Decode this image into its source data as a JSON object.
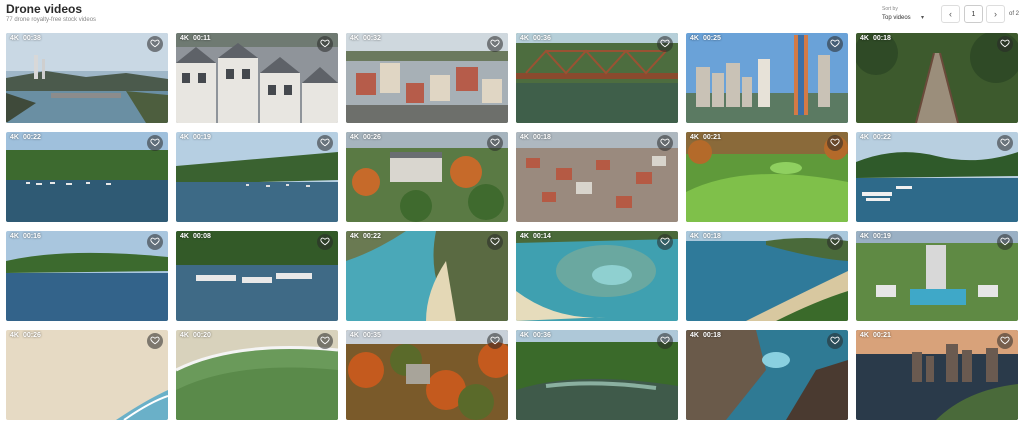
{
  "header": {
    "title": "Drone videos",
    "subtitle": "77 drone royalty-free stock videos"
  },
  "sort": {
    "label": "Sort by",
    "value": "Top videos"
  },
  "pagination": {
    "current_page": "1",
    "of_label": "of 2"
  },
  "colors": {
    "badge_text": "#ffffff",
    "fav_bg": "#3a3a3a"
  },
  "videos": [
    {
      "quality": "4K",
      "duration": "00:38",
      "scene": "river-dam-power-plant"
    },
    {
      "quality": "4K",
      "duration": "00:11",
      "scene": "townhouse-rooftops"
    },
    {
      "quality": "4K",
      "duration": "00:32",
      "scene": "small-city-downtown"
    },
    {
      "quality": "4K",
      "duration": "00:36",
      "scene": "rusty-truss-bridge"
    },
    {
      "quality": "4K",
      "duration": "00:25",
      "scene": "city-skyscrapers"
    },
    {
      "quality": "4K",
      "duration": "00:18",
      "scene": "forest-footbridge"
    },
    {
      "quality": "4K",
      "duration": "00:22",
      "scene": "lake-marina"
    },
    {
      "quality": "4K",
      "duration": "00:19",
      "scene": "lake-docks"
    },
    {
      "quality": "4K",
      "duration": "00:26",
      "scene": "campus-autumn"
    },
    {
      "quality": "4K",
      "duration": "00:18",
      "scene": "town-aerial"
    },
    {
      "quality": "4K",
      "duration": "00:21",
      "scene": "golf-course"
    },
    {
      "quality": "4K",
      "duration": "00:22",
      "scene": "lake-boats"
    },
    {
      "quality": "4K",
      "duration": "00:16",
      "scene": "wide-lake"
    },
    {
      "quality": "4K",
      "duration": "00:08",
      "scene": "marina-boats"
    },
    {
      "quality": "4K",
      "duration": "00:22",
      "scene": "tropical-bay"
    },
    {
      "quality": "4K",
      "duration": "00:14",
      "scene": "reef-bay"
    },
    {
      "quality": "4K",
      "duration": "00:18",
      "scene": "coast-beach"
    },
    {
      "quality": "4K",
      "duration": "00:19",
      "scene": "temple-gardens"
    },
    {
      "quality": "4K",
      "duration": "00:26",
      "scene": "sandy-beach"
    },
    {
      "quality": "4K",
      "duration": "00:20",
      "scene": "beach-waves"
    },
    {
      "quality": "4K",
      "duration": "00:35",
      "scene": "autumn-forest"
    },
    {
      "quality": "4K",
      "duration": "00:36",
      "scene": "forest-river"
    },
    {
      "quality": "4K",
      "duration": "00:18",
      "scene": "rocky-coast"
    },
    {
      "quality": "4K",
      "duration": "00:21",
      "scene": "sunset-city-coast"
    }
  ]
}
